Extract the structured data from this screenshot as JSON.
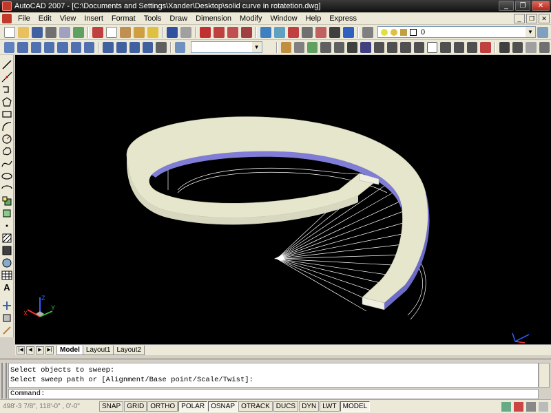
{
  "window": {
    "title": "AutoCAD 2007 - [C:\\Documents and Settings\\Xander\\Desktop\\solid curve in rotatetion.dwg]",
    "controls": [
      "_",
      "❐",
      "✕"
    ]
  },
  "menu": [
    "File",
    "Edit",
    "View",
    "Insert",
    "Format",
    "Tools",
    "Draw",
    "Dimension",
    "Modify",
    "Window",
    "Help",
    "Express"
  ],
  "doc_controls": [
    "_",
    "❐",
    "✕"
  ],
  "toolbar": {
    "layer_value": "0",
    "view_value": ""
  },
  "left_tools": [
    "line-icon",
    "construction-line-icon",
    "polyline-icon",
    "polygon-icon",
    "rectangle-icon",
    "arc-icon",
    "circle-icon",
    "revision-cloud-icon",
    "spline-icon",
    "ellipse-icon",
    "ellipse-arc-icon",
    "insert-block-icon",
    "make-block-icon",
    "point-icon",
    "hatch-icon",
    "gradient-icon",
    "region-icon",
    "table-icon",
    "multiline-text-icon"
  ],
  "multiline_text_glyph": "A",
  "ucs": {
    "z": "Z",
    "y": "Y",
    "x": "X"
  },
  "tabs": [
    "Model",
    "Layout1",
    "Layout2"
  ],
  "active_tab": "Model",
  "command": {
    "history": [
      "Select objects to sweep:",
      "Select sweep path or [Alignment/Base point/Scale/Twist]:"
    ],
    "prompt": "Command:"
  },
  "status": {
    "coords": "498'-3 7/8\", 118'-0\" , 0'-0\"",
    "buttons": [
      {
        "label": "SNAP",
        "on": false
      },
      {
        "label": "GRID",
        "on": false
      },
      {
        "label": "ORTHO",
        "on": false
      },
      {
        "label": "POLAR",
        "on": true
      },
      {
        "label": "OSNAP",
        "on": true
      },
      {
        "label": "OTRACK",
        "on": false
      },
      {
        "label": "DUCS",
        "on": false
      },
      {
        "label": "DYN",
        "on": false
      },
      {
        "label": "LWT",
        "on": false
      },
      {
        "label": "MODEL",
        "on": true
      }
    ]
  },
  "colors": {
    "viewport_bg": "#000000",
    "solid_top": "#e8e8d0",
    "solid_side": "#7a78d8",
    "wire": "#ffffff"
  }
}
